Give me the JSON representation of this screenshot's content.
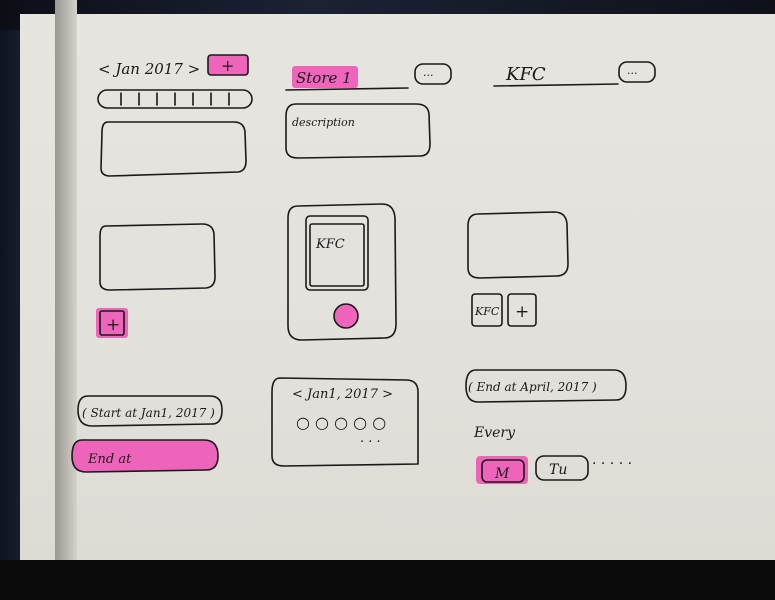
{
  "sketch": {
    "screen1": {
      "month_label": "< Jan 2017 >",
      "add_glyph": "+",
      "bottom_add_glyph": "+",
      "start_label": "( Start at Jan1, 2017 )",
      "end_label": "End at"
    },
    "screen2": {
      "store_label": "Store 1",
      "more_glyph": "...",
      "description_label": "description",
      "card_label": "KFC",
      "month_label": "< Jan1, 2017 >",
      "dots_row": "○ ○ ○ ○ ○",
      "dots_row2": ". . ."
    },
    "screen3": {
      "store_label": "KFC",
      "more_glyph": "...",
      "chip_label": "KFC",
      "chip_add_glyph": "+",
      "end_label": "( End at April, 2017 )",
      "every_label": "Every",
      "day1_label": "M",
      "day2_label": "Tu",
      "ellipsis": "· · · · ·"
    }
  },
  "colors": {
    "highlighter": "#f04fb5",
    "ink": "#1a1a1a",
    "paper": "#e4e2dc"
  }
}
